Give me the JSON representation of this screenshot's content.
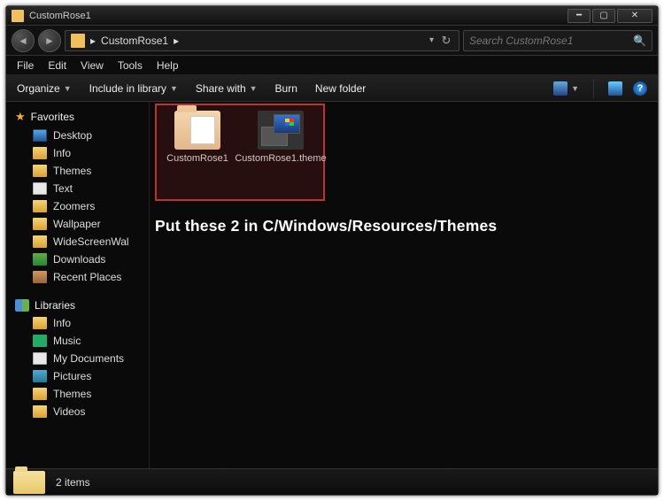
{
  "window": {
    "title": "CustomRose1"
  },
  "nav": {
    "path_label": "CustomRose1",
    "path_sep": "▸",
    "search_placeholder": "Search CustomRose1"
  },
  "menu": {
    "file": "File",
    "edit": "Edit",
    "view": "View",
    "tools": "Tools",
    "help": "Help"
  },
  "toolbar": {
    "organize": "Organize",
    "include": "Include in library",
    "share": "Share with",
    "burn": "Burn",
    "newfolder": "New folder"
  },
  "sidebar": {
    "favorites_label": "Favorites",
    "favorites": [
      {
        "label": "Desktop",
        "icon": "mon"
      },
      {
        "label": "Info",
        "icon": "folder"
      },
      {
        "label": "Themes",
        "icon": "folder"
      },
      {
        "label": "Text",
        "icon": "doc"
      },
      {
        "label": "Zoomers",
        "icon": "folder"
      },
      {
        "label": "Wallpaper",
        "icon": "folder"
      },
      {
        "label": "WideScreenWal",
        "icon": "folder"
      },
      {
        "label": "Downloads",
        "icon": "dl"
      },
      {
        "label": "Recent Places",
        "icon": "rec"
      }
    ],
    "libraries_label": "Libraries",
    "libraries": [
      {
        "label": "Info",
        "icon": "folder"
      },
      {
        "label": "Music",
        "icon": "music"
      },
      {
        "label": "My Documents",
        "icon": "doc"
      },
      {
        "label": "Pictures",
        "icon": "pic"
      },
      {
        "label": "Themes",
        "icon": "folder"
      },
      {
        "label": "Videos",
        "icon": "folder"
      }
    ]
  },
  "content": {
    "items": [
      {
        "label": "CustomRose1",
        "type": "folder"
      },
      {
        "label": "CustomRose1.theme",
        "type": "theme"
      }
    ],
    "instruction": "Put these 2 in C/Windows/Resources/Themes"
  },
  "status": {
    "count": "2 items"
  }
}
